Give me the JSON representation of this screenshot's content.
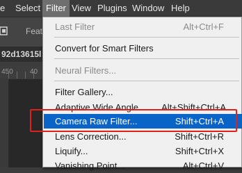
{
  "menubar": {
    "items": [
      {
        "label": "e"
      },
      {
        "label": "Select"
      },
      {
        "label": "Filter",
        "active": true
      },
      {
        "label": "View"
      },
      {
        "label": "Plugins"
      },
      {
        "label": "Window"
      },
      {
        "label": "Help"
      }
    ]
  },
  "options_bar": {
    "feature_label": "Feat"
  },
  "document": {
    "tab_title": "92d13615l"
  },
  "ruler": {
    "labels": [
      "450",
      "40"
    ]
  },
  "filter_menu": {
    "items": [
      {
        "label": "Last Filter",
        "shortcut": "Alt+Ctrl+F",
        "disabled": true
      },
      {
        "label": "Convert for Smart Filters",
        "shortcut": ""
      },
      {
        "label": "Neural Filters...",
        "shortcut": "",
        "disabled": true
      },
      {
        "label": "Filter Gallery...",
        "shortcut": ""
      },
      {
        "label": "Adaptive Wide Angle...",
        "shortcut": "Alt+Shift+Ctrl+A"
      },
      {
        "label": "Camera Raw Filter...",
        "shortcut": "Shift+Ctrl+A",
        "highlighted": true
      },
      {
        "label": "Lens Correction...",
        "shortcut": "Shift+Ctrl+R"
      },
      {
        "label": "Liquify...",
        "shortcut": "Shift+Ctrl+X"
      },
      {
        "label": "Vanishing Point...",
        "shortcut": "Alt+Ctrl+V"
      }
    ]
  },
  "colors": {
    "menubar_bg": "#3a3a3a",
    "menu_active_bg": "#6f6f6f",
    "dropdown_bg": "#f0f0f0",
    "highlight_bg": "#0a64c8",
    "annotation_border": "#e0201a"
  }
}
